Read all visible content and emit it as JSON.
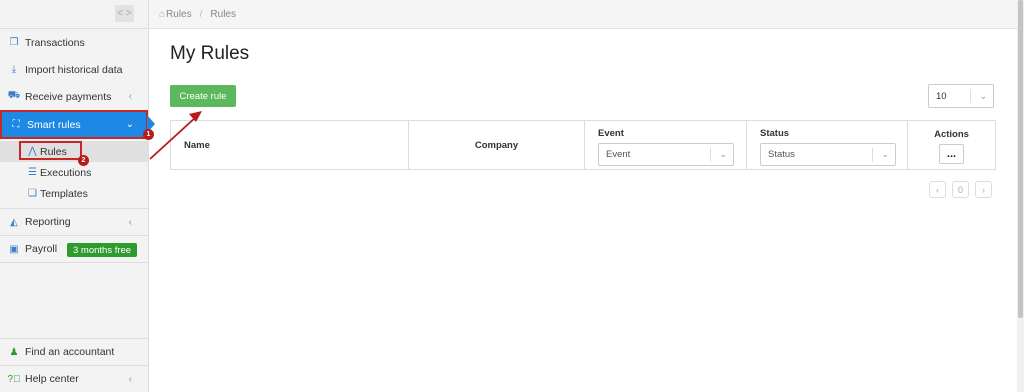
{
  "breadcrumb": {
    "home": "Rules",
    "current": "Rules"
  },
  "sidebar": {
    "items": [
      {
        "label": "Transactions",
        "icon": "document-copy-icon"
      },
      {
        "label": "Import historical data",
        "icon": "download-icon"
      },
      {
        "label": "Receive payments",
        "icon": "cart-icon"
      },
      {
        "label": "Smart rules",
        "icon": "sitemap-icon"
      },
      {
        "label": "Reporting",
        "icon": "area-chart-icon"
      },
      {
        "label": "Payroll",
        "icon": "money-icon"
      }
    ],
    "sub_items": [
      {
        "label": "Rules",
        "icon": "rule-icon"
      },
      {
        "label": "Executions",
        "icon": "list-icon"
      },
      {
        "label": "Templates",
        "icon": "copy-icon"
      }
    ],
    "payroll_badge": "3 months free",
    "bottom": [
      {
        "label": "Find an accountant",
        "icon": "accountant-icon"
      },
      {
        "label": "Help center",
        "icon": "help-icon"
      }
    ]
  },
  "annotations": {
    "step1": "1",
    "step2": "2"
  },
  "main": {
    "title": "My Rules",
    "create_label": "Create rule",
    "page_size": "10",
    "columns": {
      "name": "Name",
      "company": "Company",
      "event": "Event",
      "status": "Status",
      "actions": "Actions"
    },
    "filters": {
      "event": "Event",
      "status": "Status"
    },
    "actions_btn": "...",
    "pager": {
      "prev": "‹",
      "page": "0",
      "next": "›"
    }
  },
  "colors": {
    "accent": "#1e88e5",
    "success": "#5cb85c",
    "highlight": "#c62828"
  }
}
